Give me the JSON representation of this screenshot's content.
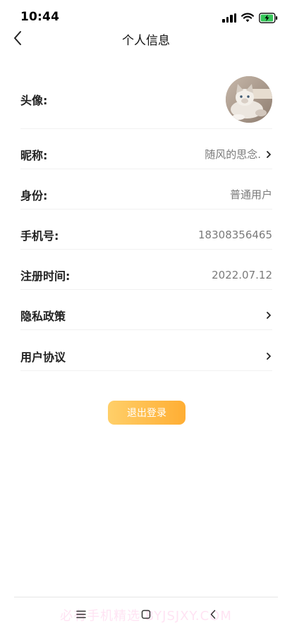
{
  "status_bar": {
    "time": "10:44"
  },
  "header": {
    "title": "个人信息"
  },
  "rows": {
    "avatar": {
      "label": "头像:"
    },
    "nickname": {
      "label": "昵称:",
      "value": "随风的思念."
    },
    "identity": {
      "label": "身份:",
      "value": "普通用户"
    },
    "phone": {
      "label": "手机号:",
      "value": "18308356465"
    },
    "register_time": {
      "label": "注册时间:",
      "value": "2022.07.12"
    },
    "privacy": {
      "label": "隐私政策"
    },
    "agreement": {
      "label": "用户协议"
    }
  },
  "logout": {
    "label": "退出登录"
  },
  "watermark": "必有手机精选  BYJSJXY.COM",
  "colors": {
    "accent_start": "#ffcf69",
    "accent_end": "#ffae34",
    "battery": "#35c759"
  },
  "icons": [
    "back-arrow-icon",
    "signal-icon",
    "wifi-icon",
    "battery-icon",
    "chevron-right-icon",
    "menu-icon",
    "home-icon"
  ]
}
